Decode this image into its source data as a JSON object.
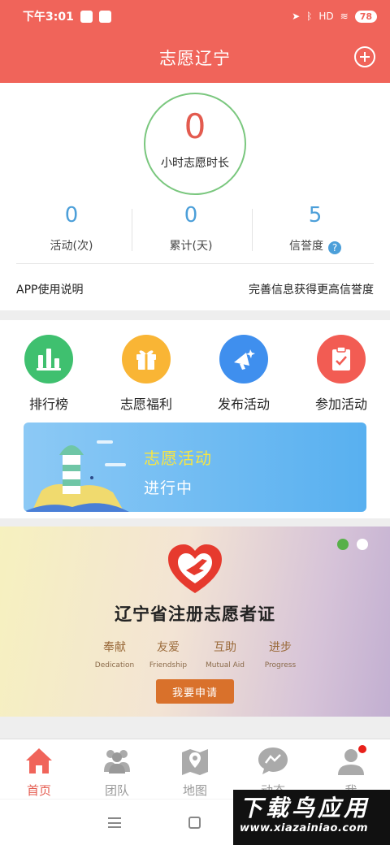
{
  "status_bar": {
    "time": "下午3:01",
    "signal": "HD",
    "battery": "78"
  },
  "header": {
    "title": "志愿辽宁"
  },
  "stats": {
    "hours_value": "0",
    "hours_label": "小时志愿时长",
    "items": [
      {
        "value": "0",
        "label": "活动(次)"
      },
      {
        "value": "0",
        "label": "累计(天)"
      },
      {
        "value": "5",
        "label": "信誉度"
      }
    ],
    "help_icon": "?",
    "app_guide": "APP使用说明",
    "improve_link": "完善信息获得更高信誉度"
  },
  "menu": {
    "items": [
      {
        "label": "排行榜",
        "icon": "bar-chart-icon",
        "color": "#3fc06f"
      },
      {
        "label": "志愿福利",
        "icon": "gift-icon",
        "color": "#f9b535"
      },
      {
        "label": "发布活动",
        "icon": "megaphone-icon",
        "color": "#3f8fee"
      },
      {
        "label": "参加活动",
        "icon": "clipboard-check-icon",
        "color": "#f25c53"
      }
    ]
  },
  "activity_banner": {
    "title": "志愿活动",
    "status": "进行中"
  },
  "cert_banner": {
    "title": "辽宁省注册志愿者证",
    "virtues": [
      {
        "zh": "奉献",
        "en": "Dedication"
      },
      {
        "zh": "友爱",
        "en": "Friendship"
      },
      {
        "zh": "互助",
        "en": "Mutual Aid"
      },
      {
        "zh": "进步",
        "en": "Progress"
      }
    ],
    "apply_button": "我要申请",
    "active_dot_color": "#58b04a",
    "inactive_dot_color": "#ffffff"
  },
  "tabs": [
    {
      "label": "首页",
      "icon": "home-icon",
      "active": true
    },
    {
      "label": "团队",
      "icon": "team-icon",
      "active": false
    },
    {
      "label": "地图",
      "icon": "map-icon",
      "active": false
    },
    {
      "label": "动态",
      "icon": "chat-icon",
      "active": false
    },
    {
      "label": "我",
      "icon": "user-icon",
      "active": false
    }
  ],
  "watermark": {
    "text": "下载鸟应用",
    "url": "www.xiazainiao.com"
  },
  "colors": {
    "brand": "#f0645a",
    "stat_blue": "#4c9fd9",
    "hours_red": "#e35b4f",
    "active_tab": "#e45b4f",
    "inactive_tab": "#999999"
  }
}
